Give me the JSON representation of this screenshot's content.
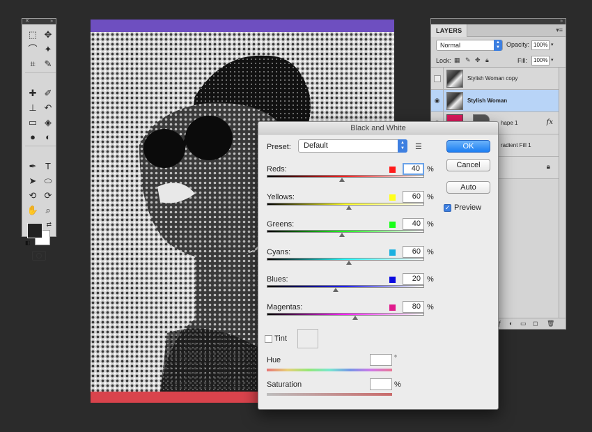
{
  "tools": {
    "icons": [
      "marquee-icon",
      "move-icon",
      "lasso-icon",
      "magic-wand-icon",
      "crop-icon",
      "eyedropper-icon",
      "healing-brush-icon",
      "brush-icon",
      "clone-stamp-icon",
      "history-brush-icon",
      "eraser-icon",
      "paint-bucket-icon",
      "blur-icon",
      "dodge-icon",
      "pen-icon",
      "type-icon",
      "path-selection-icon",
      "ellipse-shape-icon",
      "3d-rotate-icon",
      "3d-orbit-icon",
      "hand-icon",
      "zoom-icon"
    ],
    "glyphs": [
      "⬚",
      "✥",
      "⌒",
      "✦",
      "⌗",
      "✎",
      "✚",
      "✐",
      "⊥",
      "↶",
      "▭",
      "◈",
      "●",
      "◐",
      "✒",
      "T",
      "➤",
      "⬭",
      "⟲",
      "⟳",
      "✋",
      "⌕"
    ],
    "foreground": "#222222",
    "background": "#ffffff"
  },
  "canvas": {
    "top_bar_color": "#6e4fc0",
    "bottom_bar_color": "#d9434c"
  },
  "layers": {
    "tab": "LAYERS",
    "blend_mode": "Normal",
    "opacity_label": "Opacity:",
    "opacity_value": "100%",
    "lock_label": "Lock:",
    "fill_label": "Fill:",
    "fill_value": "100%",
    "items": [
      {
        "name": "Stylish Woman copy",
        "visible": false,
        "selected": false
      },
      {
        "name": "Stylish Woman",
        "visible": true,
        "selected": true
      },
      {
        "name": "hape 1",
        "visible": true,
        "selected": false
      },
      {
        "name": "radient Fill 1",
        "visible": true,
        "selected": false
      }
    ],
    "fx_label": "fx"
  },
  "dialog": {
    "title": "Black and White",
    "preset_label": "Preset:",
    "preset_value": "Default",
    "sliders": [
      {
        "label": "Reds:",
        "value": "40",
        "color": "#ff1a1a",
        "gradient": "linear-gradient(to right,#000,#ff2020,#fff)"
      },
      {
        "label": "Yellows:",
        "value": "60",
        "color": "#ffff1a",
        "gradient": "linear-gradient(to right,#000,#ffff20,#fff)"
      },
      {
        "label": "Greens:",
        "value": "40",
        "color": "#1aff1a",
        "gradient": "linear-gradient(to right,#000,#20ff20,#fff)"
      },
      {
        "label": "Cyans:",
        "value": "60",
        "color": "#1ab0e0",
        "gradient": "linear-gradient(to right,#000,#20ffff,#fff)"
      },
      {
        "label": "Blues:",
        "value": "20",
        "color": "#0a0ae0",
        "gradient": "linear-gradient(to right,#000,#2020ff,#fff)"
      },
      {
        "label": "Magentas:",
        "value": "80",
        "color": "#e01a8c",
        "gradient": "linear-gradient(to right,#000,#ff20ff,#fff)"
      }
    ],
    "tint_label": "Tint",
    "hue_label": "Hue",
    "hue_unit": "°",
    "saturation_label": "Saturation",
    "saturation_unit": "%",
    "percent": "%",
    "buttons": {
      "ok": "OK",
      "cancel": "Cancel",
      "auto": "Auto"
    },
    "preview_label": "Preview"
  }
}
